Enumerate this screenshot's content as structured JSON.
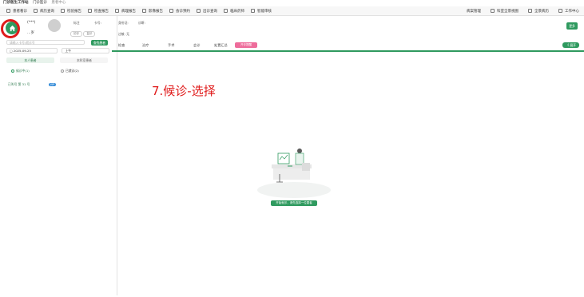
{
  "titlebar": {
    "app": "门诊医生工作站",
    "module": "门诊医诊",
    "sub": "患者中心"
  },
  "menu": [
    {
      "icon": "user-icon",
      "label": "患者看诊"
    },
    {
      "icon": "list-icon",
      "label": "病历查询"
    },
    {
      "icon": "lab-icon",
      "label": "检验报告"
    },
    {
      "icon": "warning-icon",
      "label": "检查报告"
    },
    {
      "icon": "chart-icon",
      "label": "病理报告"
    },
    {
      "icon": "image-icon",
      "label": "影像报告"
    },
    {
      "icon": "consult-icon",
      "label": "会诊预约"
    },
    {
      "icon": "calendar-icon",
      "label": "出诊查询"
    },
    {
      "icon": "clinic-icon",
      "label": "临床药师"
    },
    {
      "icon": "review-icon",
      "label": "智能审核"
    }
  ],
  "menu_right": [
    {
      "icon": "",
      "label": "病案管理"
    },
    {
      "icon": "panel-icon",
      "label": "科室全景视图"
    },
    {
      "icon": "grid-icon",
      "label": "全景病历"
    },
    {
      "icon": "work-icon",
      "label": "工作中心"
    }
  ],
  "patient": {
    "name": "(***)",
    "age_label": "…岁",
    "visit": "初诊",
    "flag": "复诊",
    "gender_label": "标注",
    "card_label": "卡号:",
    "identity_label": "身份证:",
    "diagnosis_label": "诊断:",
    "allergy_label": "过敏:",
    "allergy_value": "无",
    "more": "更多"
  },
  "left": {
    "search_placeholder": "请输入卡号/就诊号",
    "search_button": "查找患者",
    "date": "2025-09-25",
    "period": "上午",
    "tab_active": "本人患者",
    "tab_inactive": "本科室患者",
    "radio_on": "候诊中(1)",
    "radio_off": "已就诊(2)",
    "status_text": "已叫号   第 31 号",
    "status_tag": "VIP"
  },
  "tabs": [
    "检查",
    "治疗",
    "手术",
    "会诊",
    "处置汇总"
  ],
  "pink_tab": "开诊提醒",
  "collapse_btn": "《 展开",
  "annotation": "7.候诊-选择",
  "empty_cta": "开始就诊，请先选择一位患者"
}
